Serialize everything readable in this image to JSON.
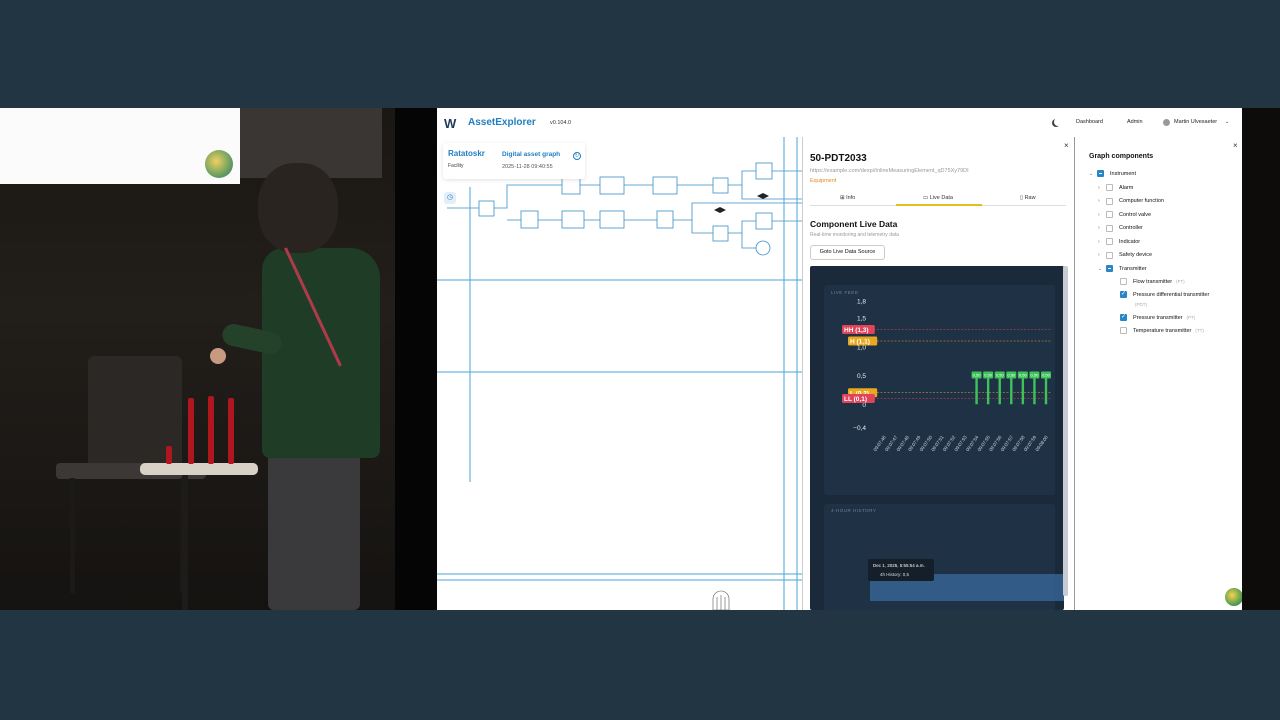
{
  "app": {
    "title": "AssetExplorer",
    "version": "v0.104.0",
    "nav": [
      "Dashboard",
      "Admin"
    ],
    "user": "Martin Ulvesaeter"
  },
  "canvas_card": {
    "facility_name": "Ratatoskr",
    "facility_type": "Facility",
    "graph_title": "Digital asset graph",
    "graph_date": "2025-11-28 09:40:55"
  },
  "detail": {
    "tag": "50-PDT2033",
    "url": "https://example.com/dexpi/InlineMeasuringElement_qD75Xy79DI",
    "category": "Equipment",
    "tabs": [
      "Info",
      "Live Data",
      "Raw"
    ],
    "active_tab": "Live Data",
    "section_title": "Component Live Data",
    "section_subtitle": "Real-time monitoring and telemetry data",
    "goto_button": "Goto Live Data Source",
    "live_feed_label": "LIVE FEED",
    "history_label": "4-HOUR HISTORY",
    "tooltip_time": "Dec 1, 2025, 5:55:54 a.m.",
    "tooltip_value": "4h History: 0,5"
  },
  "chart_data": {
    "type": "bar",
    "title": "",
    "ylim": [
      -0.5,
      1.9
    ],
    "yticks": [
      "1,8",
      "1,5",
      "1,0",
      "0,5",
      "0",
      "−0,4"
    ],
    "thresholds": [
      {
        "label": "HH (1,3)",
        "value": 1.3,
        "color": "#e0445a"
      },
      {
        "label": "H (1,1)",
        "value": 1.1,
        "color": "#e8a820"
      },
      {
        "label": "L (0,2)",
        "value": 0.2,
        "color": "#e8a820"
      },
      {
        "label": "LL (0,1)",
        "value": 0.1,
        "color": "#e0445a"
      }
    ],
    "categories": [
      "09:07:46",
      "09:07:47",
      "09:07:48",
      "09:07:49",
      "09:07:50",
      "09:07:51",
      "09:07:52",
      "09:07:53",
      "09:07:54",
      "09:07:55",
      "09:07:56",
      "09:07:57",
      "09:07:58",
      "09:07:59",
      "09:08:00"
    ],
    "values": [
      null,
      null,
      null,
      null,
      null,
      null,
      null,
      null,
      0.5,
      0.5,
      0.5,
      0.5,
      0.5,
      0.5,
      0.5
    ],
    "bar_labels": [
      "0,50",
      "0,50",
      "0,50",
      "0,50",
      "0,50",
      "0,50",
      "0,50"
    ],
    "bar_color": "#3fc25a"
  },
  "components": {
    "title": "Graph components",
    "root": "Instrument",
    "items": [
      {
        "label": "Alarm",
        "checked": false
      },
      {
        "label": "Computer function",
        "checked": false
      },
      {
        "label": "Control valve",
        "checked": false
      },
      {
        "label": "Controller",
        "checked": false
      },
      {
        "label": "Indicator",
        "checked": false
      },
      {
        "label": "Safety device",
        "checked": false
      },
      {
        "label": "Transmitter",
        "checked": "partial"
      }
    ],
    "transmitters": [
      {
        "label": "Flow transmitter",
        "abbr": "(FT)",
        "checked": false
      },
      {
        "label": "Pressure differential transmitter",
        "abbr": "(PDT)",
        "checked": true
      },
      {
        "label": "Pressure transmitter",
        "abbr": "(PT)",
        "checked": true
      },
      {
        "label": "Temperature transmitter",
        "abbr": "(TT)",
        "checked": false
      }
    ]
  }
}
